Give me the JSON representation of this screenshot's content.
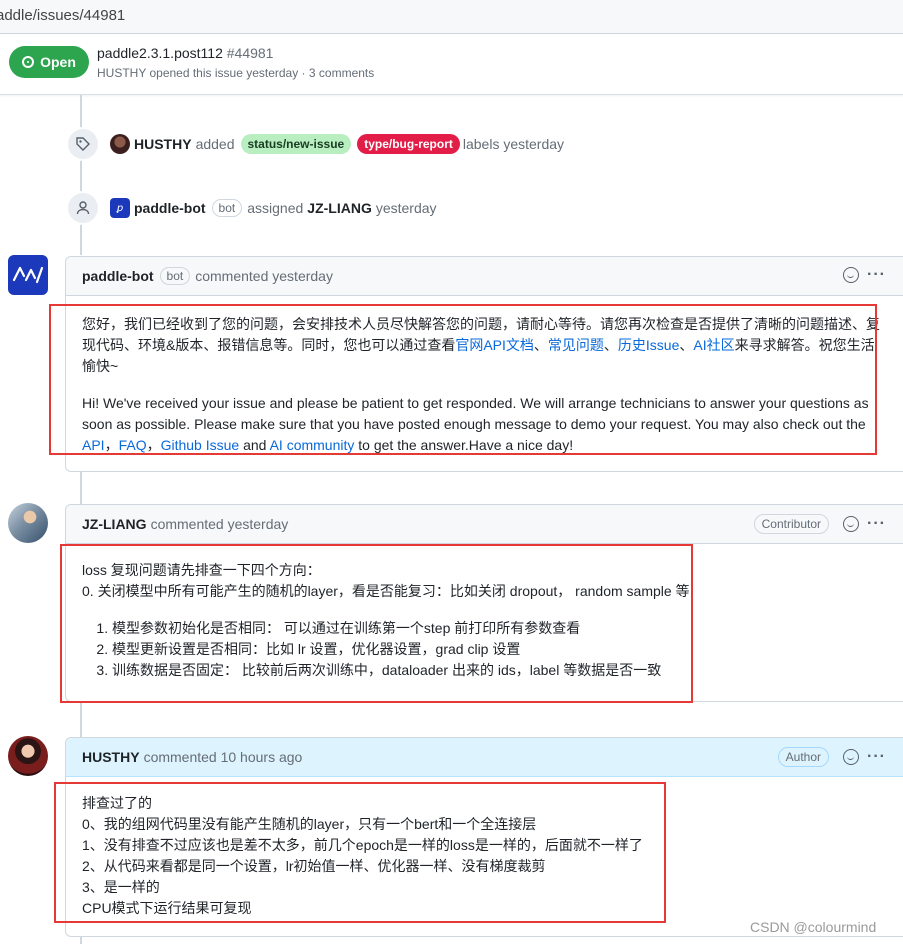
{
  "url": "addle/issues/44981",
  "issue": {
    "state": "Open",
    "title": "paddle2.3.1.post112",
    "number": "#44981",
    "opener": "HUSTHY",
    "opened_text": "opened this issue yesterday · 3 comments"
  },
  "events": [
    {
      "actor": "HUSTHY",
      "verb": "added",
      "labels": [
        "status/new-issue",
        "type/bug-report"
      ],
      "tail": "labels yesterday"
    },
    {
      "actor": "paddle-bot",
      "bot": "bot",
      "verb": "assigned",
      "target": "JZ-LIANG",
      "tail": "yesterday"
    }
  ],
  "colors": {
    "label_green": "#9be9a8",
    "label_red": "#e11d48",
    "open_green": "#2da44e",
    "link": "#0969da",
    "highlight_box": "#e53935"
  },
  "comments": [
    {
      "author": "paddle-bot",
      "bot": "bot",
      "meta": "commented yesterday",
      "zh_a": "您好，我们已经收到了您的问题，会安排技术人员尽快解答您的问题，请耐心等待。请您再次检查是否提供了清晰的问题描述、复现代码、环境&版本、报错信息等。同时，您也可以通过查看",
      "zh_link1": "官网API文档",
      "zh_sep1": "、",
      "zh_link2": "常见问题",
      "zh_sep2": "、",
      "zh_link3": "历史Issue",
      "zh_sep3": "、",
      "zh_link4": "AI社区",
      "zh_b": "来寻求解答。祝您生活愉快~",
      "en_a": "Hi! We've received your issue and please be patient to get responded. We will arrange technicians to answer your questions as soon as possible. Please make sure that you have posted enough message to demo your request. You may also check out the ",
      "en_link1": "API",
      "en_sep1": "，",
      "en_link2": "FAQ",
      "en_sep2": "，",
      "en_link3": "Github Issue",
      "en_mid": " and ",
      "en_link4": "AI community",
      "en_b": " to get the answer.Have a nice day!"
    },
    {
      "author": "JZ-LIANG",
      "meta": "commented yesterday",
      "role": "Contributor",
      "line1": "loss 复现问题请先排查一下四个方向：",
      "line2": "0. 关闭模型中所有可能产生的随机的layer，看是否能复习：比如关闭 dropout， random sample 等",
      "items": [
        "模型参数初始化是否相同： 可以通过在训练第一个step 前打印所有参数查看",
        "模型更新设置是否相同：比如 lr 设置，优化器设置，grad clip 设置",
        "训练数据是否固定： 比较前后两次训练中，dataloader 出来的 ids，label 等数据是否一致"
      ]
    },
    {
      "author": "HUSTHY",
      "meta": "commented 10 hours ago",
      "role": "Author",
      "lines": [
        "排查过了的",
        "0、我的组网代码里没有能产生随机的layer，只有一个bert和一个全连接层",
        "1、没有排查不过应该也是差不太多，前几个epoch是一样的loss是一样的，后面就不一样了",
        "2、从代码来看都是同一个设置，lr初始值一样、优化器一样、没有梯度裁剪",
        "3、是一样的",
        "CPU模式下运行结果可复现"
      ]
    }
  ],
  "watermark": "CSDN @colourmind"
}
